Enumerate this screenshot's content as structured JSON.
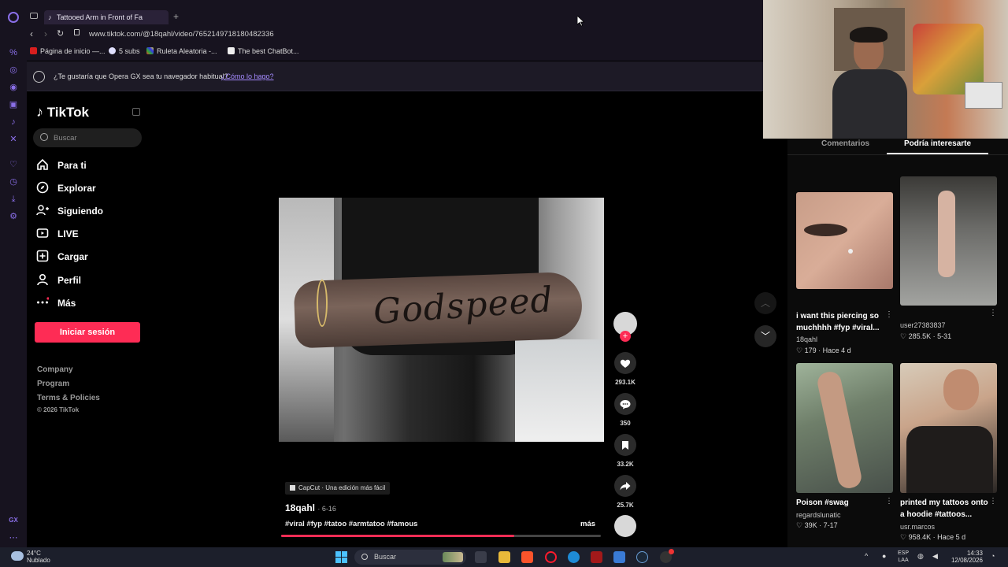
{
  "browser": {
    "tab_title": "Tattooed Arm in Front of Fa",
    "url": "www.tiktok.com/@18qahl/video/7652149718180482336",
    "bookmarks": [
      "Página de inicio —...",
      "5 subs",
      "Ruleta Aleatoria -...",
      "The best ChatBot..."
    ],
    "notification": "¿Te gustaría que Opera GX sea tu navegador habitual?",
    "notification_link": "¿Cómo lo hago?",
    "gx_label": "GX"
  },
  "tiktok": {
    "logo": "TikTok",
    "search_placeholder": "Buscar",
    "nav": [
      "Para ti",
      "Explorar",
      "Siguiendo",
      "LIVE",
      "Cargar",
      "Perfil",
      "Más"
    ],
    "login": "Iniciar sesión",
    "footer": [
      "Company",
      "Program",
      "Terms & Policies",
      "© 2026 TikTok"
    ]
  },
  "video": {
    "tattoo_text": "Godspeed",
    "capcut": "CapCut · Una edición más fácil",
    "author": "18qahl",
    "date": "· 6-16",
    "tags": "#viral #fyp #tatoo #armtatoo #famous",
    "more": "más",
    "likes": "293.1K",
    "comments": "350",
    "saves": "33.2K",
    "shares": "25.7K",
    "progress": 0.73
  },
  "panel": {
    "tab_comments": "Comentarios",
    "tab_suggest": "Podría interesarte",
    "items": [
      {
        "caption": "i want this piercing so muchhhh #fyp #viral...",
        "user": "18qahl",
        "stats": "179 · Hace 4 d"
      },
      {
        "caption": "",
        "user": "user27383837",
        "stats": "285.5K · 5-31"
      },
      {
        "caption": "Poison #swag",
        "user": "regardslunatic",
        "stats": "39K · 7-17"
      },
      {
        "caption": "printed my tattoos onto a hoodie #tattoos...",
        "user": "usr.marcos",
        "stats": "958.4K · Hace 5 d"
      }
    ]
  },
  "taskbar": {
    "weather_temp": "24°C",
    "weather_desc": "Nublado",
    "search": "Buscar",
    "lang1": "ESP",
    "lang2": "LAA",
    "time": "14:33",
    "date": "12/08/2026"
  }
}
